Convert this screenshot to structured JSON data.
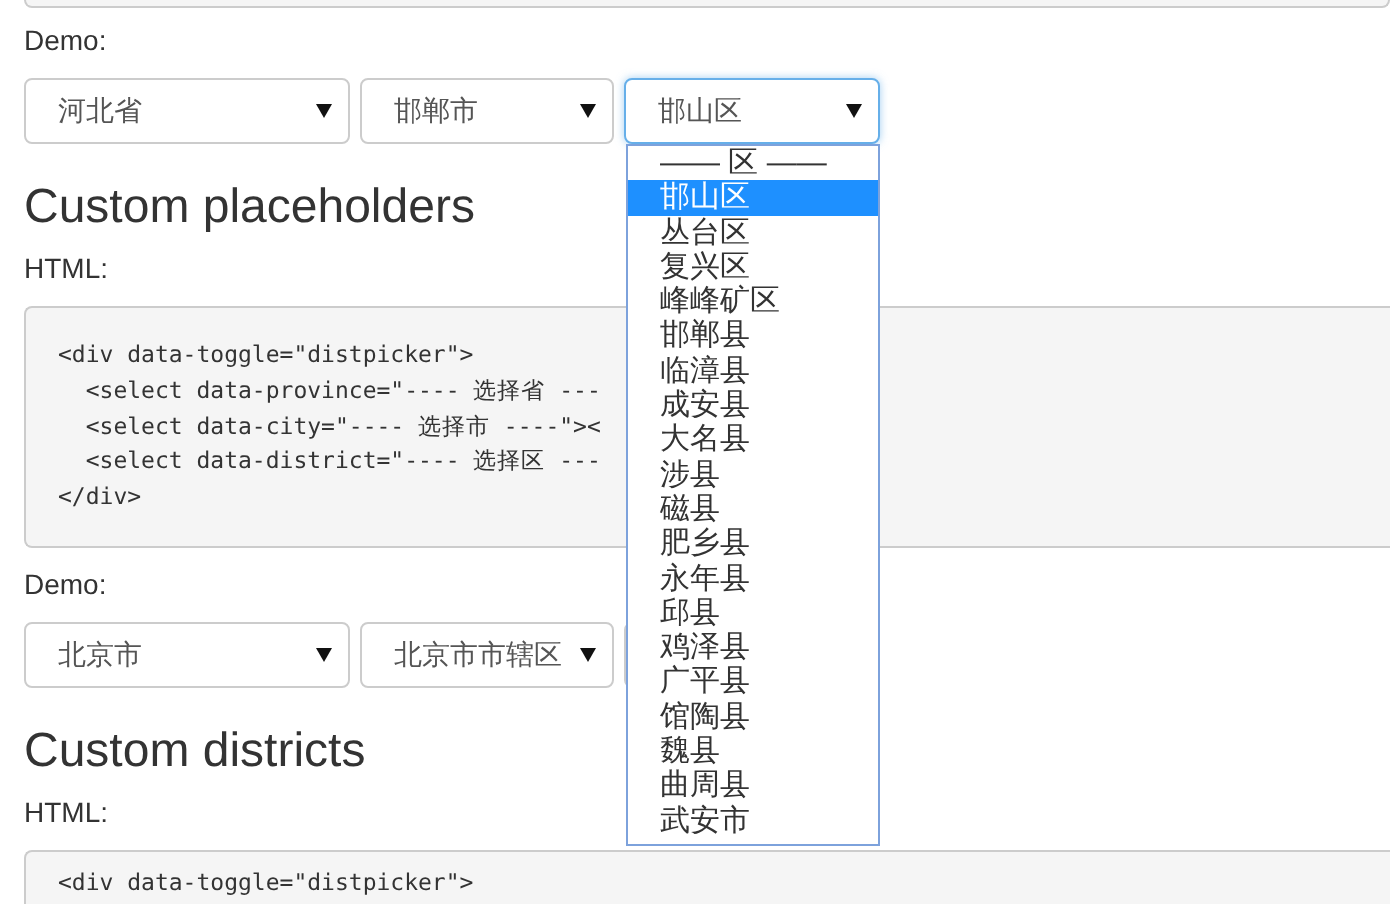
{
  "demo": {
    "label": "Demo:",
    "selects": [
      {
        "value": "河北省",
        "focused": false
      },
      {
        "value": "邯郸市",
        "focused": false
      },
      {
        "value": "邯山区",
        "focused": true
      }
    ],
    "dropdown": {
      "options": [
        {
          "label": "—— 区 ——",
          "selected": false
        },
        {
          "label": "邯山区",
          "selected": true
        },
        {
          "label": "丛台区",
          "selected": false
        },
        {
          "label": "复兴区",
          "selected": false
        },
        {
          "label": "峰峰矿区",
          "selected": false
        },
        {
          "label": "邯郸县",
          "selected": false
        },
        {
          "label": "临漳县",
          "selected": false
        },
        {
          "label": "成安县",
          "selected": false
        },
        {
          "label": "大名县",
          "selected": false
        },
        {
          "label": "涉县",
          "selected": false
        },
        {
          "label": "磁县",
          "selected": false
        },
        {
          "label": "肥乡县",
          "selected": false
        },
        {
          "label": "永年县",
          "selected": false
        },
        {
          "label": "邱县",
          "selected": false
        },
        {
          "label": "鸡泽县",
          "selected": false
        },
        {
          "label": "广平县",
          "selected": false
        },
        {
          "label": "馆陶县",
          "selected": false
        },
        {
          "label": "魏县",
          "selected": false
        },
        {
          "label": "曲周县",
          "selected": false
        },
        {
          "label": "武安市",
          "selected": false
        }
      ]
    }
  },
  "sections": [
    {
      "heading": "Custom placeholders",
      "code_label": "HTML:",
      "code_lines": [
        "<div data-toggle=\"distpicker\">",
        "  <select data-province=\"---- 选择省 ---",
        "  <select data-city=\"---- 选择市 ----\"><",
        "  <select data-district=\"---- 选择区 ---",
        "</div>"
      ],
      "demo_label": "Demo:",
      "selects": [
        {
          "value": "北京市",
          "focused": false
        },
        {
          "value": "北京市市辖区",
          "focused": false
        },
        {
          "focused": false
        }
      ]
    },
    {
      "heading": "Custom districts",
      "code_label": "HTML:",
      "code_lines": [
        "<div data-toggle=\"distpicker\">"
      ]
    }
  ]
}
